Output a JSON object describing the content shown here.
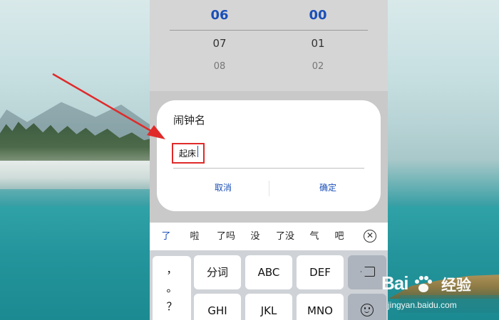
{
  "time_picker": {
    "hours": {
      "selected": "06",
      "next": "07",
      "next2": "08"
    },
    "minutes": {
      "selected": "00",
      "next": "01",
      "next2": "02"
    }
  },
  "dialog": {
    "title": "闹钟名",
    "input_value": "起床",
    "cancel_label": "取消",
    "confirm_label": "确定"
  },
  "candidates": [
    "了",
    "啦",
    "了吗",
    "没",
    "了没",
    "气",
    "吧"
  ],
  "keyboard": {
    "punctuation": [
      "，",
      "。",
      "？"
    ],
    "row1": [
      "分词",
      "ABC",
      "DEF"
    ],
    "row2": [
      "GHI",
      "JKL",
      "MNO"
    ]
  },
  "watermark": {
    "brand": "Bai",
    "brand_tail": "经验",
    "url": "jingyan.baidu.com"
  },
  "colors": {
    "accent_blue": "#1a4fb8",
    "highlight_red": "#e02a2a"
  },
  "icons": {
    "close": "close-circle-icon",
    "backspace": "backspace-icon",
    "emoji": "emoji-icon",
    "arrow": "annotation-arrow"
  }
}
